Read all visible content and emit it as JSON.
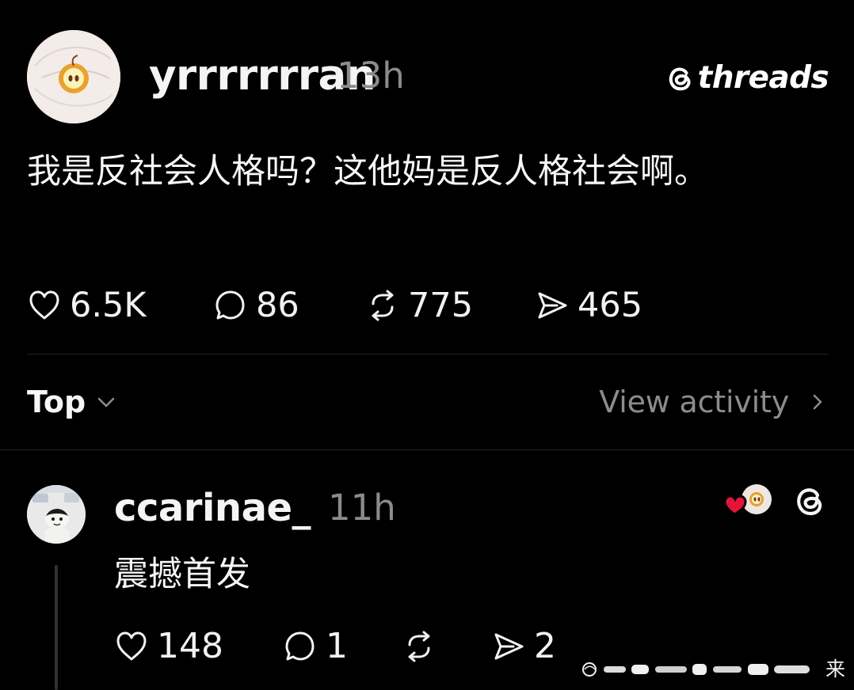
{
  "colors": {
    "background": "#000000",
    "text_primary": "#f4f4f4",
    "text_secondary": "#8c8c8c",
    "divider": "#242424",
    "like_red": "#e6133b"
  },
  "brand": {
    "logo_icon": "threads-logo-icon",
    "name": "threads"
  },
  "main_post": {
    "avatar_icon": "apple-slice-avatar-icon",
    "username": "yrrrrrrran",
    "time": "13h",
    "text": "我是反社会人格吗？这他妈是反人格社会啊。",
    "actions": [
      {
        "icon": "heart-icon",
        "label": "6.5K"
      },
      {
        "icon": "comment-icon",
        "label": "86"
      },
      {
        "icon": "repost-icon",
        "label": "775"
      },
      {
        "icon": "send-icon",
        "label": "465"
      }
    ]
  },
  "sort": {
    "label": "Top",
    "dropdown_icon": "chevron-down-icon"
  },
  "view_activity": {
    "label": "View activity",
    "icon": "chevron-right-icon"
  },
  "reply_post": {
    "avatar_icon": "character-avatar-icon",
    "username": "ccarinae_",
    "time": "11h",
    "text": "震撼首发",
    "liked_by_author_icon": "heart-with-avatar-icon",
    "threads_icon": "threads-logo-icon",
    "actions": [
      {
        "icon": "heart-icon",
        "label": "148"
      },
      {
        "icon": "comment-icon",
        "label": "1"
      },
      {
        "icon": "repost-icon",
        "label": ""
      },
      {
        "icon": "send-icon",
        "label": "2"
      }
    ]
  },
  "watermark": {
    "visible_character": "来"
  }
}
